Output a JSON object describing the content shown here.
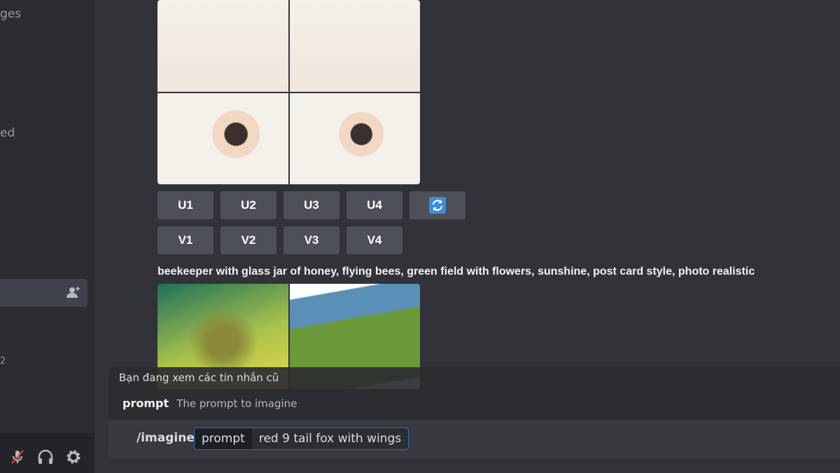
{
  "sidebar": {
    "items": [
      {
        "label": "ges"
      },
      {
        "label": "ed"
      },
      {
        "label": "2"
      }
    ],
    "icons": [
      "add-friend-icon",
      "microphone-muted-icon",
      "headphones-icon",
      "gear-icon"
    ]
  },
  "message1": {
    "buttons_row1": [
      "U1",
      "U2",
      "U3",
      "U4"
    ],
    "reroll_icon": "refresh-icon",
    "buttons_row2": [
      "V1",
      "V2",
      "V3",
      "V4"
    ],
    "accent": "#3b8fd9"
  },
  "message2": {
    "prompt": "beekeeper with glass jar of honey, flying bees, green field with flowers, sunshine, post card style, photo realistic"
  },
  "composer": {
    "notice": "Bạn đang xem các tin nhắn cũ",
    "option_name": "prompt",
    "option_desc": "The prompt to imagine",
    "command": "/imagine",
    "param_label": "prompt",
    "param_value": "red 9 tail fox with wings"
  }
}
